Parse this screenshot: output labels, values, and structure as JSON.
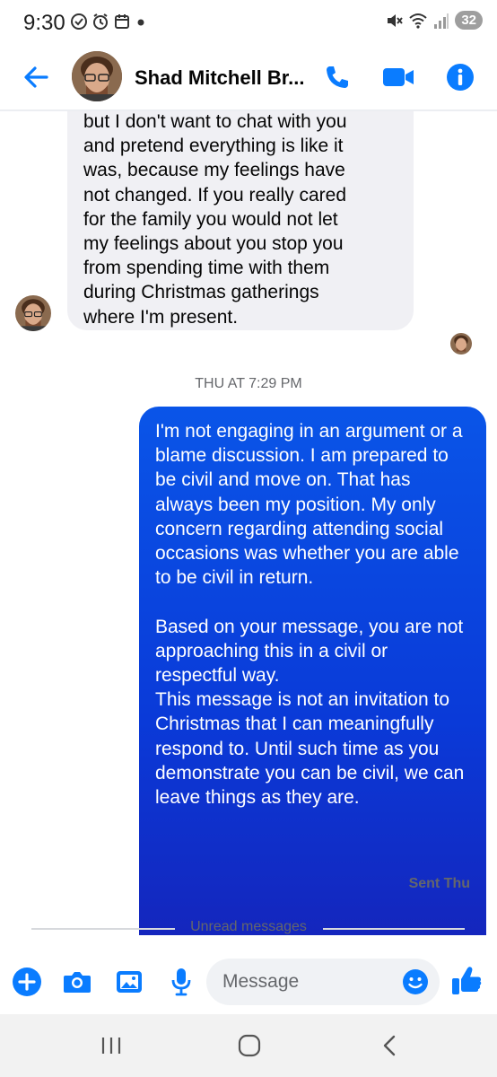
{
  "status_bar": {
    "time": "9:30",
    "battery": "32"
  },
  "header": {
    "contact_name": "Shad Mitchell Br...",
    "icons": [
      "back-arrow-icon",
      "phone-icon",
      "video-camera-icon",
      "info-icon"
    ],
    "accent_color": "#0a7cff"
  },
  "conversation": {
    "incoming_message": {
      "lines": [
        "but I don't want to chat with you",
        "and pretend everything is like it",
        "was, because my feelings have",
        "not changed. If you really cared",
        "for the family you would not let",
        "my feelings about you stop you",
        "from spending time with them",
        "during Christmas gatherings",
        "where I'm present."
      ]
    },
    "timestamp": "THU AT 7:29 PM",
    "outgoing_message": {
      "paragraph_1": "I'm not engaging in an argument or a blame discussion. I am prepared to be civil and move on. That has always been my position. My only concern regarding attending social occasions was whether you are able to be civil in return.",
      "paragraph_2": "Based on your message, you are not approaching this in a civil or respectful way.",
      "paragraph_3": "This message is not an invitation to Christmas that I can meaningfully respond to. Until such time as you demonstrate you can be civil, we can leave things as they are.",
      "bubble_color": "#0a4ae0"
    },
    "sent_status": "Sent Thu",
    "unread_divider": "Unread messages"
  },
  "composer": {
    "placeholder": "Message",
    "icons": [
      "plus-icon",
      "camera-icon",
      "gallery-icon",
      "microphone-icon",
      "emoji-icon",
      "thumbs-up-icon"
    ]
  },
  "navigation": {
    "icons": [
      "recent-apps-icon",
      "home-icon",
      "back-icon"
    ]
  }
}
